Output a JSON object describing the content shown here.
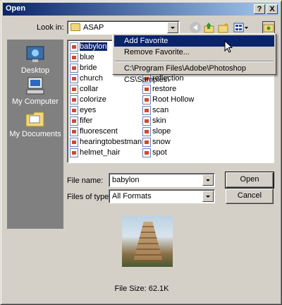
{
  "window": {
    "title": "Open",
    "help_label": "?",
    "close_label": "X"
  },
  "look_in": {
    "label": "Look in:",
    "value": "ASAP"
  },
  "places": [
    {
      "label": "Desktop"
    },
    {
      "label": "My Computer"
    },
    {
      "label": "My Documents"
    }
  ],
  "files": {
    "column1": [
      "babylon",
      "blue",
      "bride",
      "church",
      "collar",
      "colorize",
      "eyes",
      "fifer",
      "fluorescent",
      "hearingtobestman",
      "helmet_hair"
    ],
    "column2": [
      "",
      "",
      "",
      "reflection",
      "restore",
      "Root Hollow",
      "scan",
      "skin",
      "slope",
      "snow",
      "spot"
    ],
    "selected": "babylon"
  },
  "context_menu": {
    "items": [
      "Add Favorite",
      "Remove Favorite...",
      "C:\\Program Files\\Adobe\\Photoshop CS\\Samples\\"
    ],
    "highlighted": "Add Favorite"
  },
  "file_name": {
    "label": "File name:",
    "value": "babylon"
  },
  "file_type": {
    "label": "Files of type:",
    "value": "All Formats"
  },
  "buttons": {
    "open": "Open",
    "cancel": "Cancel"
  },
  "file_size": "File Size: 62.1K",
  "colors": {
    "titlebar": "#0a246a",
    "face": "#d4d0c8",
    "selection": "#0a246a",
    "places_bg": "#808080"
  }
}
